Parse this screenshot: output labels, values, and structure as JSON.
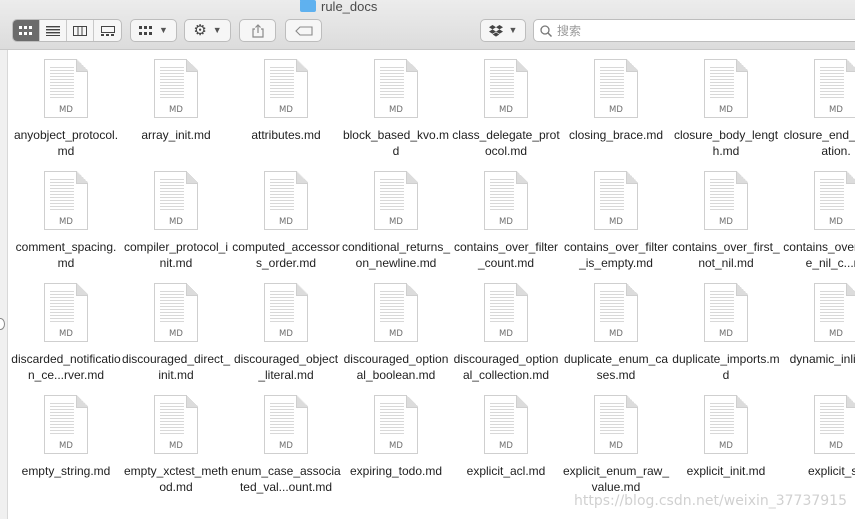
{
  "window": {
    "title": "rule_docs"
  },
  "toolbar": {
    "view_buttons": [
      {
        "name": "icon-view",
        "active": true
      },
      {
        "name": "list-view",
        "active": false
      },
      {
        "name": "column-view",
        "active": false
      },
      {
        "name": "gallery-view",
        "active": false
      }
    ],
    "group_button": "group-by-icon",
    "action_button": "gear-icon",
    "share_button": "share-icon",
    "tag_button": "tag-icon",
    "dropbox_button": "dropbox-icon"
  },
  "search": {
    "placeholder": "搜索",
    "value": ""
  },
  "file_type_label": "MD",
  "files": [
    "anyobject_protocol.md",
    "array_init.md",
    "attributes.md",
    "block_based_kvo.md",
    "class_delegate_protocol.md",
    "closing_brace.md",
    "closure_body_length.md",
    "closure_end_indentation.",
    "comment_spacing.md",
    "compiler_protocol_init.md",
    "computed_accessors_order.md",
    "conditional_returns_on_newline.md",
    "contains_over_filter_count.md",
    "contains_over_filter_is_empty.md",
    "contains_over_first_not_nil.md",
    "contains_over_range_nil_c...ris",
    "discarded_notification_ce...rver.md",
    "discouraged_direct_init.md",
    "discouraged_object_literal.md",
    "discouraged_optional_boolean.md",
    "discouraged_optional_collection.md",
    "duplicate_enum_cases.md",
    "duplicate_imports.md",
    "dynamic_inline_d",
    "empty_string.md",
    "empty_xctest_method.md",
    "enum_case_associated_val...ount.md",
    "expiring_todo.md",
    "explicit_acl.md",
    "explicit_enum_raw_value.md",
    "explicit_init.md",
    "explicit_se"
  ],
  "watermark": "https://blog.csdn.net/weixin_37737915",
  "colors": {
    "accent": "#5fb1ef",
    "active_segment": "#6b6b6b"
  }
}
